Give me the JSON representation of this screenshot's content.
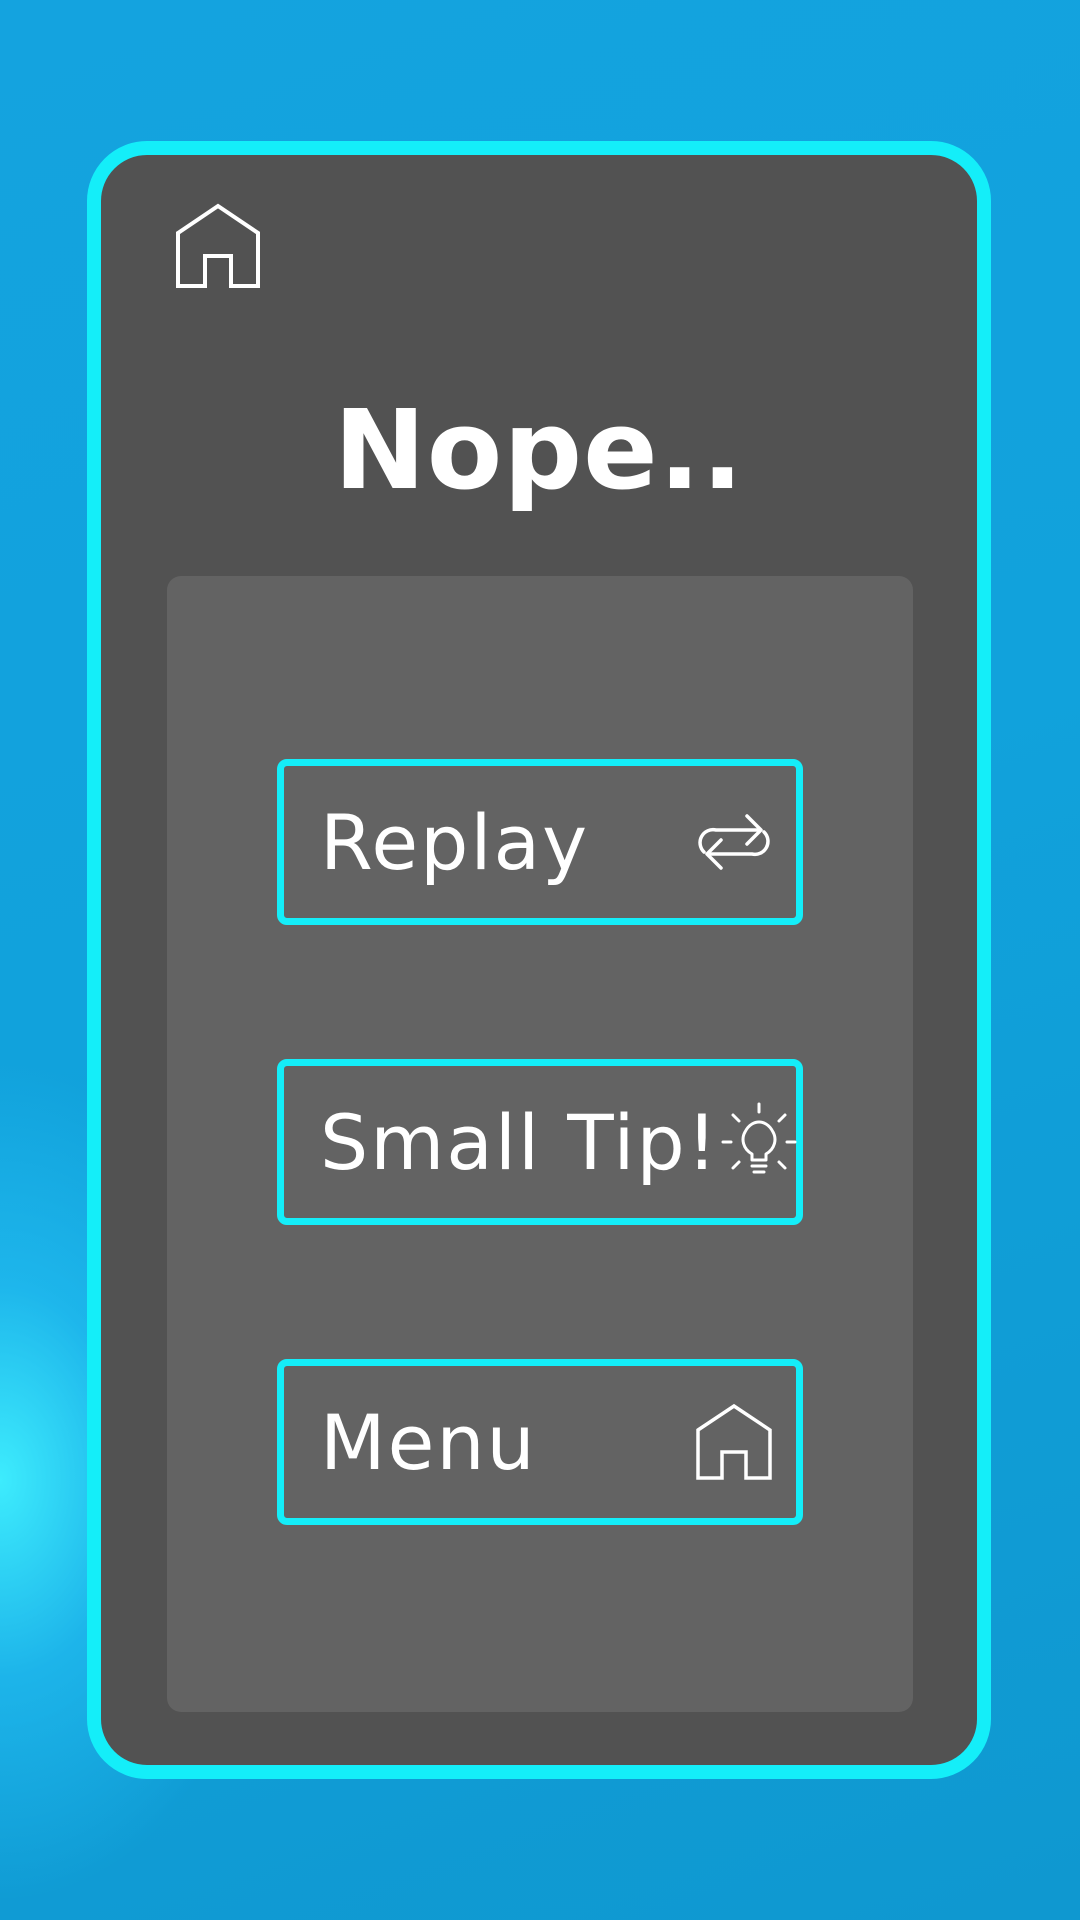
{
  "screen": {
    "title": "Nope..",
    "top_home_icon": "home-icon"
  },
  "buttons": [
    {
      "label": "Replay",
      "icon": "replay-icon"
    },
    {
      "label": "Small Tip!",
      "icon": "lightbulb-icon"
    },
    {
      "label": "Menu",
      "icon": "home-icon"
    }
  ],
  "colors": {
    "background": "#12a0da",
    "background_glow": "#3ff0ff",
    "accent_border": "#14eef9",
    "card": "#525252",
    "panel": "#636363",
    "text": "#ffffff"
  }
}
